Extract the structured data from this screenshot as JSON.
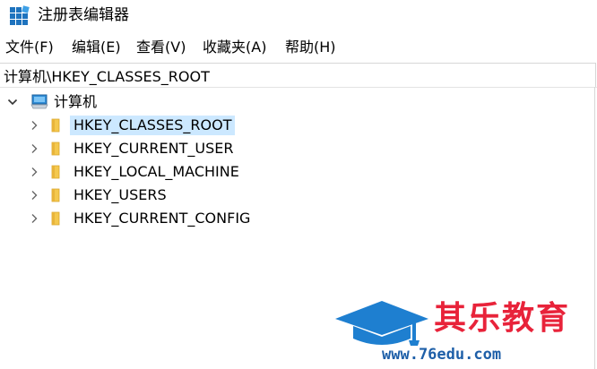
{
  "window": {
    "title": "注册表编辑器"
  },
  "menu": [
    {
      "label": "文件(F)"
    },
    {
      "label": "编辑(E)"
    },
    {
      "label": "查看(V)"
    },
    {
      "label": "收藏夹(A)"
    },
    {
      "label": "帮助(H)"
    }
  ],
  "address": {
    "value": "计算机\\HKEY_CLASSES_ROOT"
  },
  "tree": {
    "root": {
      "label": "计算机",
      "icon": "computer-icon",
      "expanded": true
    },
    "children": [
      {
        "label": "HKEY_CLASSES_ROOT",
        "icon": "folder-icon",
        "selected": true
      },
      {
        "label": "HKEY_CURRENT_USER",
        "icon": "folder-icon",
        "selected": false
      },
      {
        "label": "HKEY_LOCAL_MACHINE",
        "icon": "folder-icon",
        "selected": false
      },
      {
        "label": "HKEY_USERS",
        "icon": "folder-icon",
        "selected": false
      },
      {
        "label": "HKEY_CURRENT_CONFIG",
        "icon": "folder-icon",
        "selected": false
      }
    ]
  },
  "watermark": {
    "brand": "其乐教育",
    "url": "www.76edu.com",
    "icon": "graduation-cap-icon"
  },
  "colors": {
    "selection": "#cce8ff",
    "folder": "#f4c84e",
    "brand_red": "#e8233a",
    "brand_blue": "#1e7fd0"
  }
}
